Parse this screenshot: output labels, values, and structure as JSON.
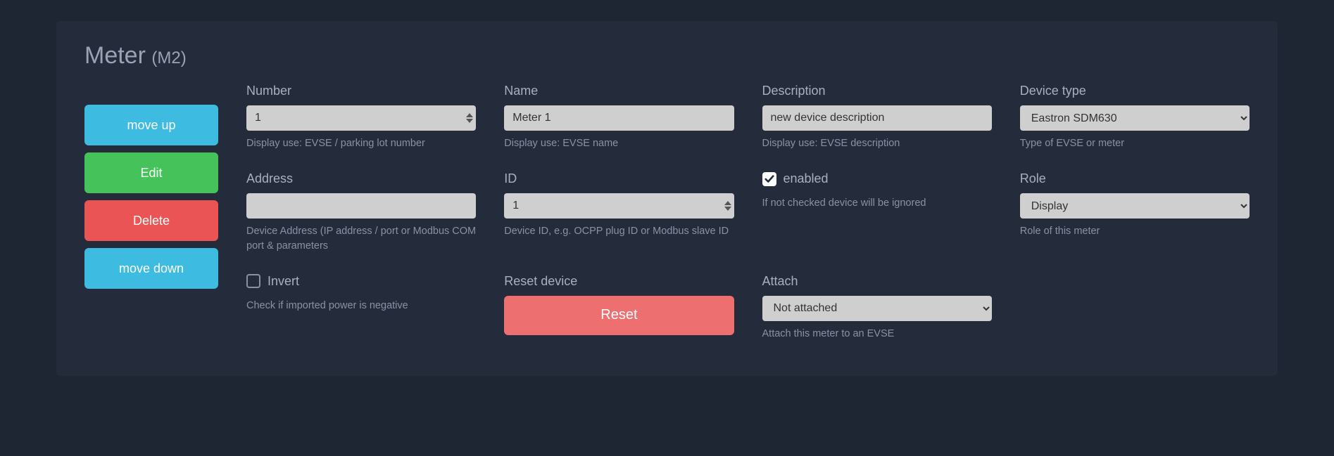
{
  "title": {
    "main": "Meter",
    "sub": "(M2)"
  },
  "sidebar": {
    "move_up": "move up",
    "edit": "Edit",
    "delete": "Delete",
    "move_down": "move down"
  },
  "fields": {
    "number": {
      "label": "Number",
      "value": "1",
      "help": "Display use: EVSE / parking lot number"
    },
    "name": {
      "label": "Name",
      "value": "Meter 1",
      "help": "Display use: EVSE name"
    },
    "description": {
      "label": "Description",
      "value": "new device description",
      "help": "Display use: EVSE description"
    },
    "device_type": {
      "label": "Device type",
      "value": "Eastron SDM630",
      "help": "Type of EVSE or meter"
    },
    "address": {
      "label": "Address",
      "value": "",
      "help": "Device Address (IP address / port or Modbus COM port & parameters"
    },
    "id": {
      "label": "ID",
      "value": "1",
      "help": "Device ID, e.g. OCPP plug ID or Modbus slave ID"
    },
    "enabled": {
      "label": "enabled",
      "help": "If not checked device will be ignored",
      "checked": true
    },
    "role": {
      "label": "Role",
      "value": "Display",
      "help": "Role of this meter"
    },
    "invert": {
      "label": "Invert",
      "help": "Check if imported power is negative",
      "checked": false
    },
    "reset": {
      "label": "Reset device",
      "button": "Reset"
    },
    "attach": {
      "label": "Attach",
      "value": "Not attached",
      "help": "Attach this meter to an EVSE"
    }
  }
}
